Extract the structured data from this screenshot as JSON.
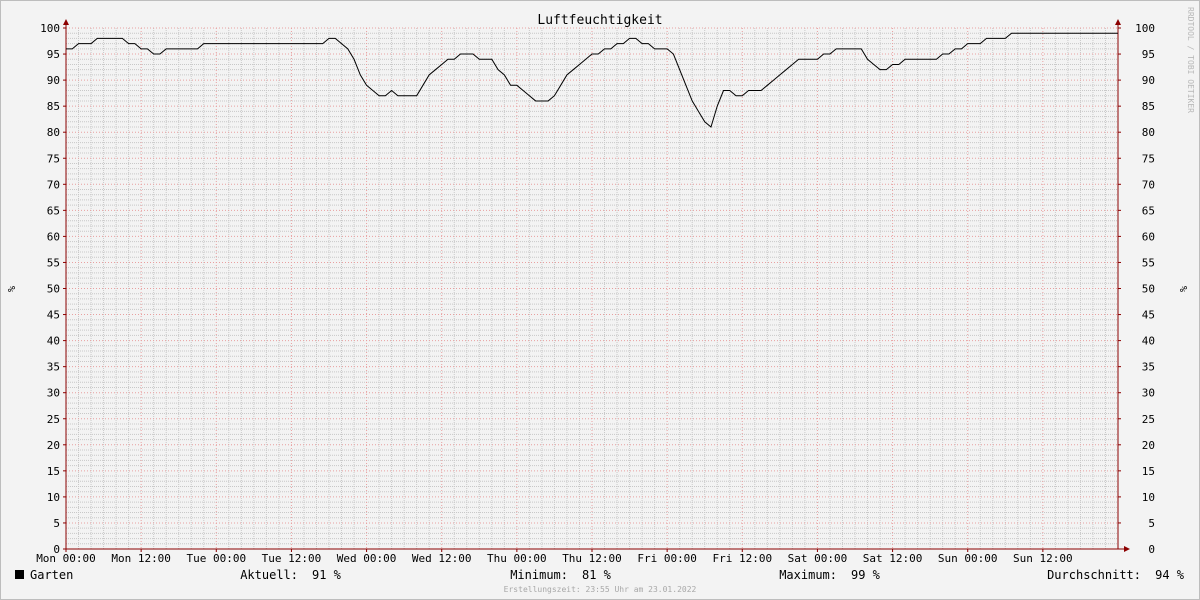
{
  "watermark": "RRDTOOL / TOBI OETIKER",
  "chart_data": {
    "type": "line",
    "title": "Luftfeuchtigkeit",
    "ylabel": "%",
    "ylim": [
      0,
      100
    ],
    "y_ticks": [
      0,
      5,
      10,
      15,
      20,
      25,
      30,
      35,
      40,
      45,
      50,
      55,
      60,
      65,
      70,
      75,
      80,
      85,
      90,
      95,
      100
    ],
    "x_range_hours": [
      0,
      168
    ],
    "x_tick_labels": [
      "Mon 00:00",
      "Mon 12:00",
      "Tue 00:00",
      "Tue 12:00",
      "Wed 00:00",
      "Wed 12:00",
      "Thu 00:00",
      "Thu 12:00",
      "Fri 00:00",
      "Fri 12:00",
      "Sat 00:00",
      "Sat 12:00",
      "Sun 00:00",
      "Sun 12:00"
    ],
    "grid": true,
    "legend_position": "bottom-left",
    "colors": {
      "line": "#000000",
      "major_grid": "#e8a0a0",
      "minor_grid": "#c8c8c8",
      "axis": "#8b0000"
    },
    "series": [
      {
        "name": "Garten",
        "x_hours": [
          0,
          1,
          2,
          3,
          4,
          5,
          6,
          7,
          8,
          9,
          10,
          11,
          12,
          13,
          14,
          15,
          16,
          17,
          18,
          19,
          20,
          21,
          22,
          23,
          24,
          25,
          26,
          27,
          28,
          29,
          30,
          31,
          32,
          33,
          34,
          35,
          36,
          37,
          38,
          39,
          40,
          41,
          42,
          43,
          44,
          45,
          46,
          47,
          48,
          49,
          50,
          51,
          52,
          53,
          54,
          55,
          56,
          57,
          58,
          59,
          60,
          61,
          62,
          63,
          64,
          65,
          66,
          67,
          68,
          69,
          70,
          71,
          72,
          73,
          74,
          75,
          76,
          77,
          78,
          79,
          80,
          81,
          82,
          83,
          84,
          85,
          86,
          87,
          88,
          89,
          90,
          91,
          92,
          93,
          94,
          95,
          96,
          97,
          98,
          99,
          100,
          101,
          102,
          103,
          104,
          105,
          106,
          107,
          108,
          109,
          110,
          111,
          112,
          113,
          114,
          115,
          116,
          117,
          118,
          119,
          120,
          121,
          122,
          123,
          124,
          125,
          126,
          127,
          128,
          129,
          130,
          131,
          132,
          133,
          134,
          135,
          136,
          137,
          138,
          139,
          140,
          141,
          142,
          143,
          144,
          145,
          146,
          147,
          148,
          149,
          150,
          151,
          152,
          153,
          154,
          155,
          156,
          157,
          158,
          159,
          160,
          161,
          162,
          163,
          164,
          165,
          166,
          167,
          168
        ],
        "values": [
          96,
          96,
          97,
          97,
          97,
          98,
          98,
          98,
          98,
          98,
          97,
          97,
          96,
          96,
          95,
          95,
          96,
          96,
          96,
          96,
          96,
          96,
          97,
          97,
          97,
          97,
          97,
          97,
          97,
          97,
          97,
          97,
          97,
          97,
          97,
          97,
          97,
          97,
          97,
          97,
          97,
          97,
          98,
          98,
          97,
          96,
          94,
          91,
          89,
          88,
          87,
          87,
          88,
          87,
          87,
          87,
          87,
          89,
          91,
          92,
          93,
          94,
          94,
          95,
          95,
          95,
          94,
          94,
          94,
          92,
          91,
          89,
          89,
          88,
          87,
          86,
          86,
          86,
          87,
          89,
          91,
          92,
          93,
          94,
          95,
          95,
          96,
          96,
          97,
          97,
          98,
          98,
          97,
          97,
          96,
          96,
          96,
          95,
          92,
          89,
          86,
          84,
          82,
          81,
          85,
          88,
          88,
          87,
          87,
          88,
          88,
          88,
          89,
          90,
          91,
          92,
          93,
          94,
          94,
          94,
          94,
          95,
          95,
          96,
          96,
          96,
          96,
          96,
          94,
          93,
          92,
          92,
          93,
          93,
          94,
          94,
          94,
          94,
          94,
          94,
          95,
          95,
          96,
          96,
          97,
          97,
          97,
          98,
          98,
          98,
          98,
          99,
          99,
          99,
          99,
          99,
          99,
          99,
          99,
          99,
          99,
          99,
          99,
          99,
          99,
          99,
          99,
          99,
          99,
          99,
          99,
          99,
          99,
          99,
          99,
          99,
          99,
          99,
          99,
          99,
          99,
          99,
          99,
          99,
          99,
          99,
          98,
          97,
          96,
          95,
          95,
          94,
          94,
          94,
          95,
          95,
          94,
          94,
          93,
          93,
          93,
          92,
          91
        ]
      }
    ]
  },
  "legend": {
    "swatch_color": "#000000",
    "series_label": "Garten",
    "aktuell_label": "Aktuell:",
    "aktuell_value": "91 %",
    "minimum_label": "Minimum:",
    "minimum_value": "81 %",
    "maximum_label": "Maximum:",
    "maximum_value": "99 %",
    "durchschnitt_label": "Durchschnitt:",
    "durchschnitt_value": "94 %"
  },
  "footer": "Erstellungszeit: 23:55 Uhr am 23.01.2022"
}
